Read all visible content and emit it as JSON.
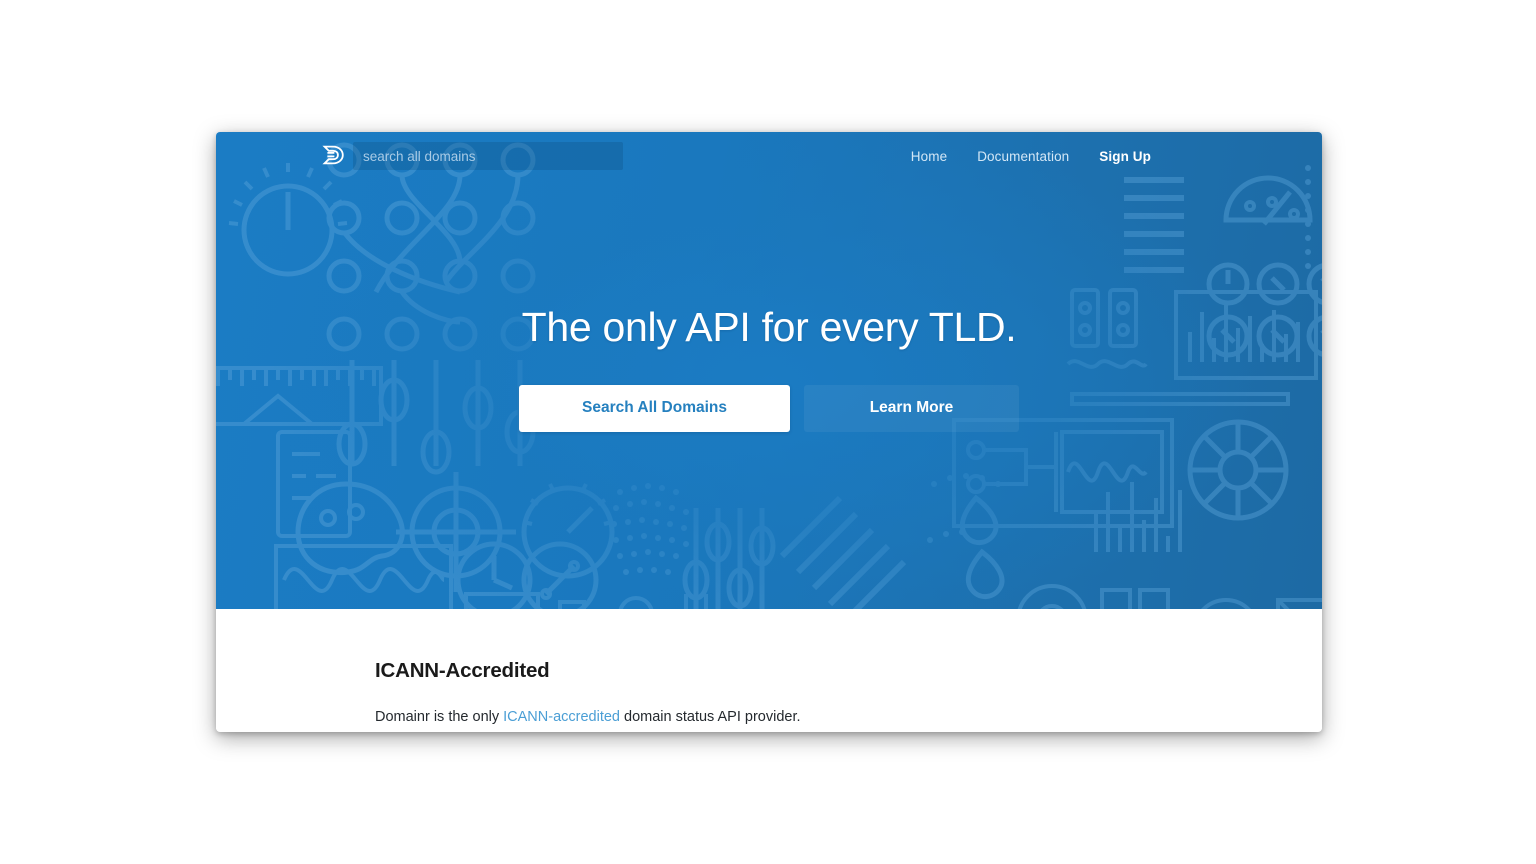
{
  "site": {
    "name": "Domainr",
    "logo_icon": "domainr-d-logo-icon"
  },
  "header": {
    "search": {
      "placeholder": "search all domains",
      "value": "",
      "icon": "search-icon"
    },
    "nav": [
      {
        "label": "Home",
        "active": false
      },
      {
        "label": "Documentation",
        "active": false
      },
      {
        "label": "Sign Up",
        "active": true
      }
    ]
  },
  "hero": {
    "headline": "The only API for every TLD.",
    "primary_cta": "Search All Domains",
    "secondary_cta": "Learn More",
    "background_color": "#1b79be",
    "background_color_dark": "#1d6aa4"
  },
  "section": {
    "heading": "ICANN-Accredited",
    "body_before": "Domainr is the only ",
    "body_link": "ICANN-accredited",
    "body_after": " domain status API provider.",
    "link_color": "#4a9ed5"
  }
}
